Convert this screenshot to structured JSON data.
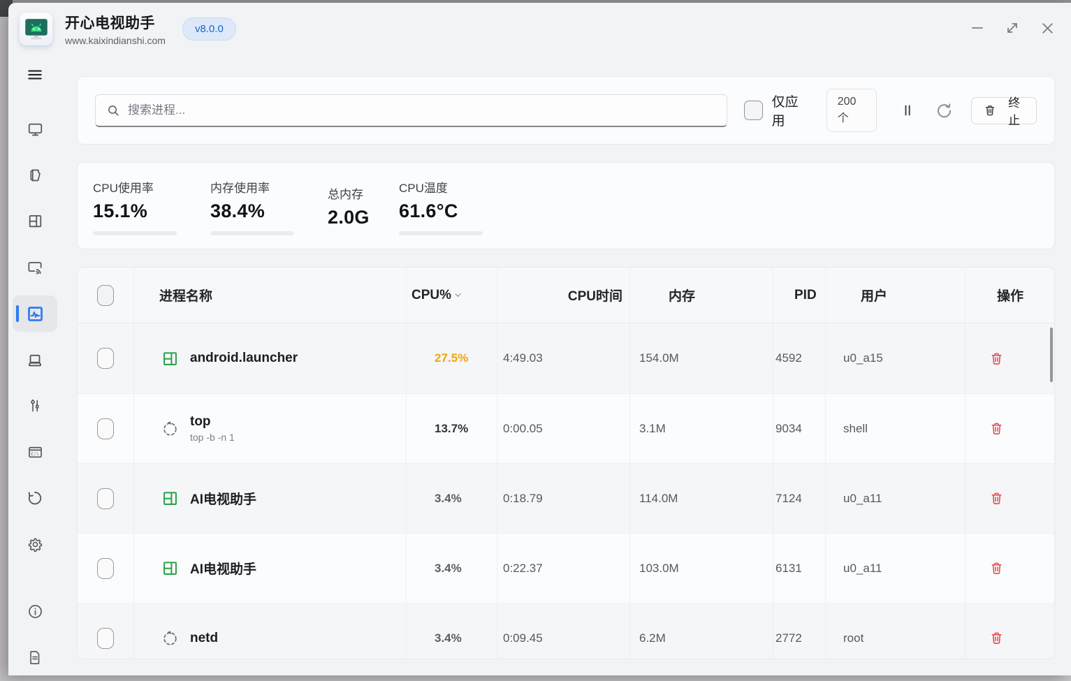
{
  "titlebar": {
    "title": "开心电视助手",
    "url": "www.kaixindianshi.com",
    "version": "v8.0.0"
  },
  "window_controls": [
    "minimize",
    "maximize",
    "close"
  ],
  "sidebar": {
    "items": [
      {
        "icon": "menu-icon",
        "active": false
      },
      {
        "icon": "tv-icon",
        "active": false
      },
      {
        "icon": "folder-icon",
        "active": false
      },
      {
        "icon": "apps-icon",
        "active": false
      },
      {
        "icon": "cast-icon",
        "active": false
      },
      {
        "icon": "activity-icon",
        "active": true
      },
      {
        "icon": "laptop-icon",
        "active": false
      },
      {
        "icon": "tools-icon",
        "active": false
      },
      {
        "icon": "terminal-icon",
        "active": false
      },
      {
        "icon": "history-icon",
        "active": false
      },
      {
        "icon": "settings-icon",
        "active": false
      },
      {
        "icon": "info-icon",
        "active": false
      },
      {
        "icon": "document-icon",
        "active": false
      }
    ]
  },
  "toolbar": {
    "search_placeholder": "搜索进程...",
    "apps_only_label": "仅应用",
    "count_badge": "200个",
    "terminate_label": "终止"
  },
  "stats": [
    {
      "label": "CPU使用率",
      "value": "15.1%",
      "percent": 15.1,
      "color": "#2470e8"
    },
    {
      "label": "内存使用率",
      "value": "38.4%",
      "percent": 38.4,
      "color": "#e8650e"
    },
    {
      "label": "总内存",
      "value": "2.0G",
      "percent": null,
      "color": null
    },
    {
      "label": "CPU温度",
      "value": "61.6°C",
      "percent": 61.6,
      "color": "#e8650e"
    }
  ],
  "table": {
    "columns": [
      "进程名称",
      "CPU%",
      "CPU时间",
      "内存",
      "PID",
      "用户",
      "操作"
    ],
    "sort": {
      "column": "CPU%",
      "direction": "desc"
    },
    "rows": [
      {
        "icon": "app-grid-icon",
        "name": "android.launcher",
        "subtitle": "",
        "cpu": "27.5%",
        "cpu_style": "hot",
        "time": "4:49.03",
        "mem": "154.0M",
        "pid": "4592",
        "user": "u0_a15"
      },
      {
        "icon": "spinner-icon",
        "name": "top",
        "subtitle": "top -b -n 1",
        "cpu": "13.7%",
        "cpu_style": "medium",
        "time": "0:00.05",
        "mem": "3.1M",
        "pid": "9034",
        "user": "shell"
      },
      {
        "icon": "app-grid-icon",
        "name": "AI电视助手",
        "subtitle": "",
        "cpu": "3.4%",
        "cpu_style": "normal",
        "time": "0:18.79",
        "mem": "114.0M",
        "pid": "7124",
        "user": "u0_a11"
      },
      {
        "icon": "app-grid-icon",
        "name": "AI电视助手",
        "subtitle": "",
        "cpu": "3.4%",
        "cpu_style": "normal",
        "time": "0:22.37",
        "mem": "103.0M",
        "pid": "6131",
        "user": "u0_a11"
      },
      {
        "icon": "spinner-icon",
        "name": "netd",
        "subtitle": "",
        "cpu": "3.4%",
        "cpu_style": "normal",
        "time": "0:09.45",
        "mem": "6.2M",
        "pid": "2772",
        "user": "root"
      }
    ]
  },
  "colors": {
    "accent_blue": "#2e7cf6",
    "progress_blue": "#2470e8",
    "progress_orange": "#e8650e",
    "cpu_hot_amber": "#f0a60d",
    "danger_red": "#e5484d",
    "android_green": "#2ba24c",
    "badge_blue": "#1a66c6"
  }
}
